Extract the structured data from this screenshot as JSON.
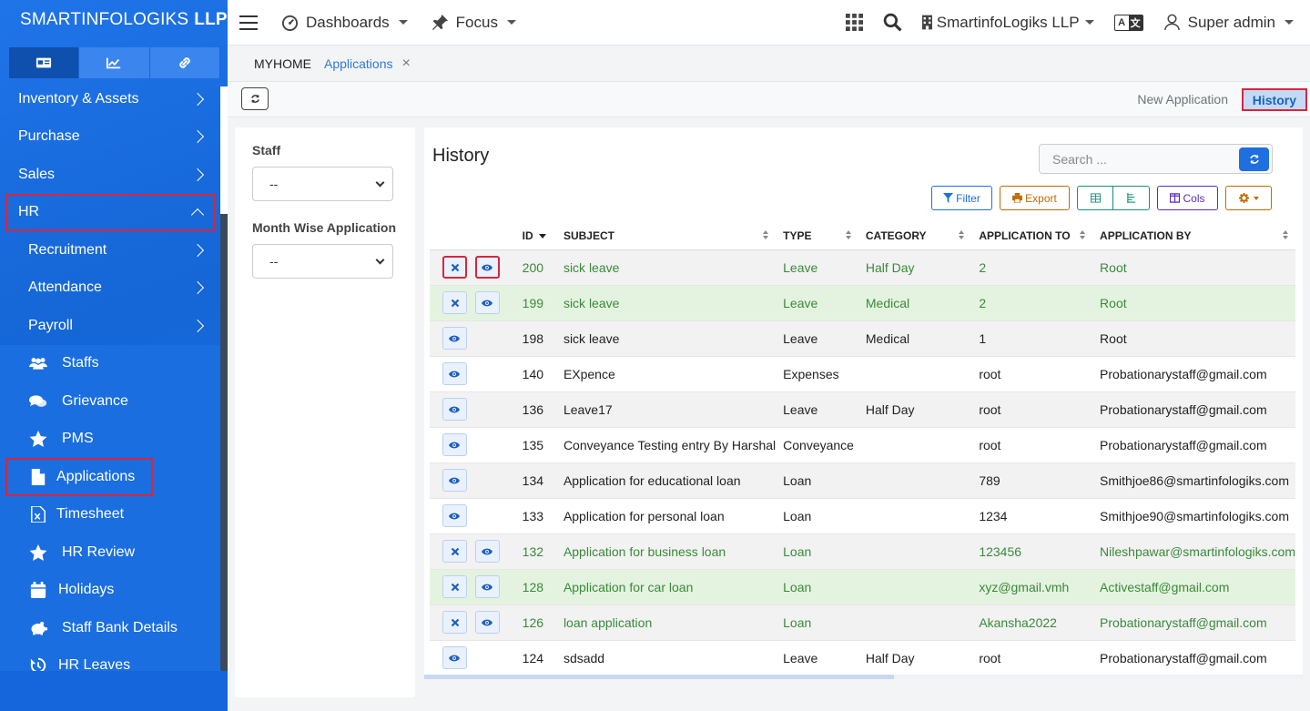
{
  "brand": {
    "name": "SMARTINFOLOGIKS",
    "suffix": "LLP"
  },
  "sidebar": {
    "menus": [
      {
        "label": "Inventory & Assets"
      },
      {
        "label": "Purchase"
      },
      {
        "label": "Sales"
      },
      {
        "label": "HR"
      },
      {
        "label": "Recruitment"
      },
      {
        "label": "Attendance"
      },
      {
        "label": "Payroll"
      }
    ],
    "leaves": [
      {
        "label": "Staffs",
        "icon": "users-icon"
      },
      {
        "label": "Grievance",
        "icon": "comments-icon"
      },
      {
        "label": "PMS",
        "icon": "star-icon"
      },
      {
        "label": "Applications",
        "icon": "file-icon"
      },
      {
        "label": "Timesheet",
        "icon": "excel-file-icon"
      },
      {
        "label": "HR Review",
        "icon": "star-icon"
      },
      {
        "label": "Holidays",
        "icon": "calendar-icon"
      },
      {
        "label": "Staff Bank Details",
        "icon": "piggy-bank-icon"
      },
      {
        "label": "HR Leaves",
        "icon": "history-icon"
      }
    ]
  },
  "topbar": {
    "dashboards": "Dashboards",
    "focus": "Focus",
    "company": "SmartinfoLogiks LLP",
    "user": "Super admin"
  },
  "breadcrumb": {
    "home": "MYHOME",
    "current": "Applications",
    "close": "×"
  },
  "actions": {
    "new_application": "New Application",
    "history": "History"
  },
  "filters": {
    "staff_label": "Staff",
    "staff_value": "--",
    "month_label": "Month Wise Application",
    "month_value": "--"
  },
  "card": {
    "title": "History",
    "search_placeholder": "Search ...",
    "tools": {
      "filter": "Filter",
      "export": "Export",
      "cols": "Cols"
    }
  },
  "table": {
    "headers": {
      "id": "ID",
      "subject": "SUBJECT",
      "type": "TYPE",
      "category": "CATEGORY",
      "to": "APPLICATION TO",
      "by": "APPLICATION BY"
    },
    "rows": [
      {
        "id": "200",
        "subject": "sick leave",
        "type": "Leave",
        "category": "Half Day",
        "to": "2",
        "by": "Root",
        "style": "odd gt",
        "del": true
      },
      {
        "id": "199",
        "subject": "sick leave",
        "type": "Leave",
        "category": "Medical",
        "to": "2",
        "by": "Root",
        "style": "green gt",
        "del": true
      },
      {
        "id": "198",
        "subject": "sick leave",
        "type": "Leave",
        "category": "Medical",
        "to": "1",
        "by": "Root",
        "style": "odd",
        "del": false
      },
      {
        "id": "140",
        "subject": "EXpence",
        "type": "Expenses",
        "category": "",
        "to": "root",
        "by": "Probationarystaff@gmail.com",
        "style": "",
        "del": false
      },
      {
        "id": "136",
        "subject": "Leave17",
        "type": "Leave",
        "category": "Half Day",
        "to": "root",
        "by": "Probationarystaff@gmail.com",
        "style": "odd",
        "del": false
      },
      {
        "id": "135",
        "subject": "Conveyance Testing entry By Harshal",
        "type": "Conveyance",
        "category": "",
        "to": "root",
        "by": "Probationarystaff@gmail.com",
        "style": "",
        "del": false
      },
      {
        "id": "134",
        "subject": "Application for educational loan",
        "type": "Loan",
        "category": "",
        "to": "789",
        "by": "Smithjoe86@smartinfologiks.com",
        "style": "odd",
        "del": false
      },
      {
        "id": "133",
        "subject": "Application for personal loan",
        "type": "Loan",
        "category": "",
        "to": "1234",
        "by": "Smithjoe90@smartinfologiks.com",
        "style": "",
        "del": false
      },
      {
        "id": "132",
        "subject": "Application for business loan",
        "type": "Loan",
        "category": "",
        "to": "123456",
        "by": "Nileshpawar@smartinfologiks.com",
        "style": "odd gt",
        "del": true
      },
      {
        "id": "128",
        "subject": "Application for car loan",
        "type": "Loan",
        "category": "",
        "to": "xyz@gmail.vmh",
        "by": "Activestaff@gmail.com",
        "style": "green gt",
        "del": true
      },
      {
        "id": "126",
        "subject": "loan application",
        "type": "Loan",
        "category": "",
        "to": "Akansha2022",
        "by": "Probationarystaff@gmail.com",
        "style": "odd gt",
        "del": true
      },
      {
        "id": "124",
        "subject": "sdsadd",
        "type": "Leave",
        "category": "Half Day",
        "to": "root",
        "by": "Probationarystaff@gmail.com",
        "style": "",
        "del": false
      }
    ]
  },
  "colors": {
    "sidebar": "#1a6ee0",
    "accent": "#1f6fe0",
    "highlight": "#d7263d"
  }
}
